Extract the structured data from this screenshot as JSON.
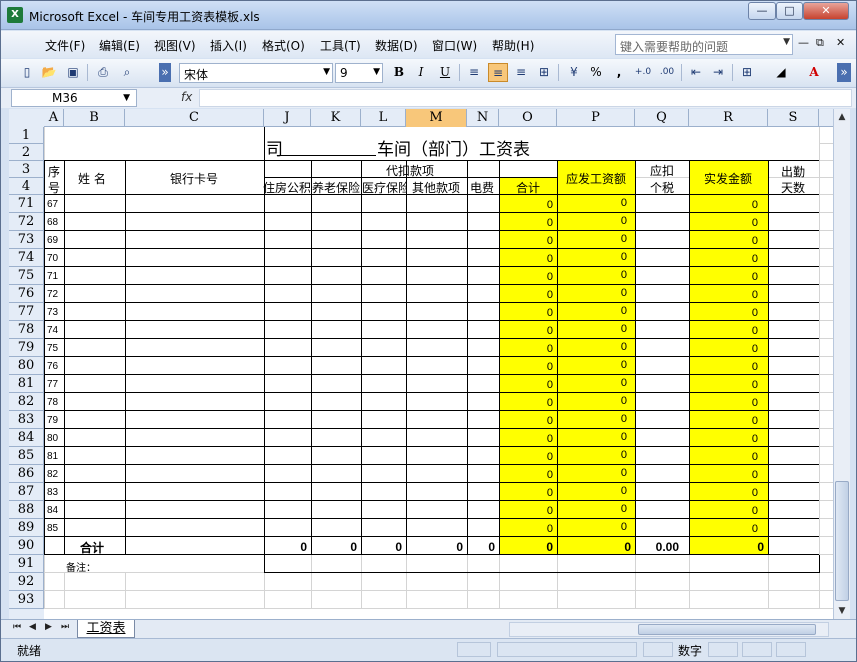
{
  "window": {
    "title": "Microsoft Excel - 车间专用工资表模板.xls",
    "app_icon": "X"
  },
  "menu": {
    "items": [
      "文件(F)",
      "编辑(E)",
      "视图(V)",
      "插入(I)",
      "格式(O)",
      "工具(T)",
      "数据(D)",
      "窗口(W)",
      "帮助(H)"
    ],
    "help_placeholder": "键入需要帮助的问题"
  },
  "toolbar": {
    "font": "宋体",
    "size": "9",
    "bold": "B",
    "italic": "I",
    "underline": "U",
    "percent": "%",
    "comma": ","
  },
  "formula_bar": {
    "cell_ref": "M36",
    "fx": "fx",
    "content": ""
  },
  "columns": [
    "A",
    "B",
    "C",
    "J",
    "K",
    "L",
    "M",
    "N",
    "O",
    "P",
    "Q",
    "R",
    "S"
  ],
  "selected_column": "M",
  "selected_cell": "M36",
  "visible_rows": [
    1,
    2,
    3,
    4,
    71,
    72,
    73,
    74,
    75,
    76,
    77,
    78,
    79,
    80,
    81,
    82,
    83,
    84,
    85,
    86,
    87,
    88,
    89,
    90,
    91,
    92,
    93
  ],
  "sheet": {
    "title_left": "司",
    "title_main": "车间（部门）工资表",
    "header": {
      "seq": "序号",
      "seq_top": "序",
      "seq_bottom": "号",
      "name": "姓 名",
      "bank": "银行卡号",
      "deduct_group": "代扣款项",
      "housing": "住房公积",
      "pension": "养老保险",
      "medical": "医疗保险",
      "other": "其他款项",
      "electric": "电费",
      "subtotal": "合计",
      "gross": "应发工资额",
      "tax_top": "应扣",
      "tax_bottom": "个税",
      "net": "实发金额",
      "att_top": "出勤",
      "att_bottom": "天数"
    },
    "data_rows": [
      {
        "row": 71,
        "seq": "67",
        "total": "0",
        "gross": "0",
        "net": "0"
      },
      {
        "row": 72,
        "seq": "68",
        "total": "0",
        "gross": "0",
        "net": "0"
      },
      {
        "row": 73,
        "seq": "69",
        "total": "0",
        "gross": "0",
        "net": "0"
      },
      {
        "row": 74,
        "seq": "70",
        "total": "0",
        "gross": "0",
        "net": "0"
      },
      {
        "row": 75,
        "seq": "71",
        "total": "0",
        "gross": "0",
        "net": "0"
      },
      {
        "row": 76,
        "seq": "72",
        "total": "0",
        "gross": "0",
        "net": "0"
      },
      {
        "row": 77,
        "seq": "73",
        "total": "0",
        "gross": "0",
        "net": "0"
      },
      {
        "row": 78,
        "seq": "74",
        "total": "0",
        "gross": "0",
        "net": "0"
      },
      {
        "row": 79,
        "seq": "75",
        "total": "0",
        "gross": "0",
        "net": "0"
      },
      {
        "row": 80,
        "seq": "76",
        "total": "0",
        "gross": "0",
        "net": "0"
      },
      {
        "row": 81,
        "seq": "77",
        "total": "0",
        "gross": "0",
        "net": "0"
      },
      {
        "row": 82,
        "seq": "78",
        "total": "0",
        "gross": "0",
        "net": "0"
      },
      {
        "row": 83,
        "seq": "79",
        "total": "0",
        "gross": "0",
        "net": "0"
      },
      {
        "row": 84,
        "seq": "80",
        "total": "0",
        "gross": "0",
        "net": "0"
      },
      {
        "row": 85,
        "seq": "81",
        "total": "0",
        "gross": "0",
        "net": "0"
      },
      {
        "row": 86,
        "seq": "82",
        "total": "0",
        "gross": "0",
        "net": "0"
      },
      {
        "row": 87,
        "seq": "83",
        "total": "0",
        "gross": "0",
        "net": "0"
      },
      {
        "row": 88,
        "seq": "84",
        "total": "0",
        "gross": "0",
        "net": "0"
      },
      {
        "row": 89,
        "seq": "85",
        "total": "0",
        "gross": "0",
        "net": "0"
      }
    ],
    "totals": {
      "label": "合计",
      "J": "0",
      "K": "0",
      "L": "0",
      "M": "0",
      "N": "0",
      "O": "0",
      "P": "0",
      "Q": "0.00",
      "R": "0"
    },
    "note": "备注："
  },
  "sheet_tabs": [
    "工资表"
  ],
  "status": {
    "ready": "就绪",
    "mode": "数字"
  },
  "colors": {
    "highlight": "#ffff00",
    "selected_header": "#f8c77a"
  }
}
